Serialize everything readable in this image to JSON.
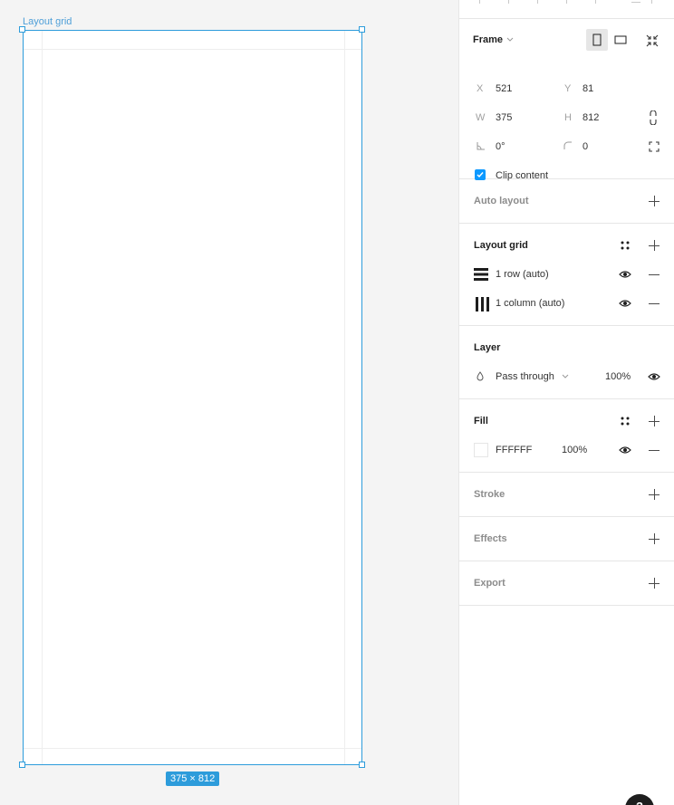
{
  "canvas": {
    "frame_label": "Layout grid",
    "size_badge": "375 × 812"
  },
  "frame_section": {
    "title": "Frame",
    "x_label": "X",
    "x_value": "521",
    "y_label": "Y",
    "y_value": "81",
    "w_label": "W",
    "w_value": "375",
    "h_label": "H",
    "h_value": "812",
    "rotation_value": "0°",
    "radius_value": "0",
    "clip_content_label": "Clip content",
    "clip_content_checked": true
  },
  "auto_layout": {
    "title": "Auto layout"
  },
  "layout_grid": {
    "title": "Layout grid",
    "items": [
      {
        "label": "1 row (auto)",
        "icon": "grid-rows-icon"
      },
      {
        "label": "1 column (auto)",
        "icon": "grid-columns-icon"
      }
    ]
  },
  "layer": {
    "title": "Layer",
    "blend_mode": "Pass through",
    "opacity": "100%"
  },
  "fill": {
    "title": "Fill",
    "hex": "FFFFFF",
    "opacity": "100%",
    "swatch_color": "#FFFFFF"
  },
  "stroke": {
    "title": "Stroke"
  },
  "effects": {
    "title": "Effects"
  },
  "export": {
    "title": "Export"
  },
  "help": {
    "label": "?"
  },
  "colors": {
    "selection": "#2D9CDB",
    "checkbox": "#0D99FF"
  }
}
